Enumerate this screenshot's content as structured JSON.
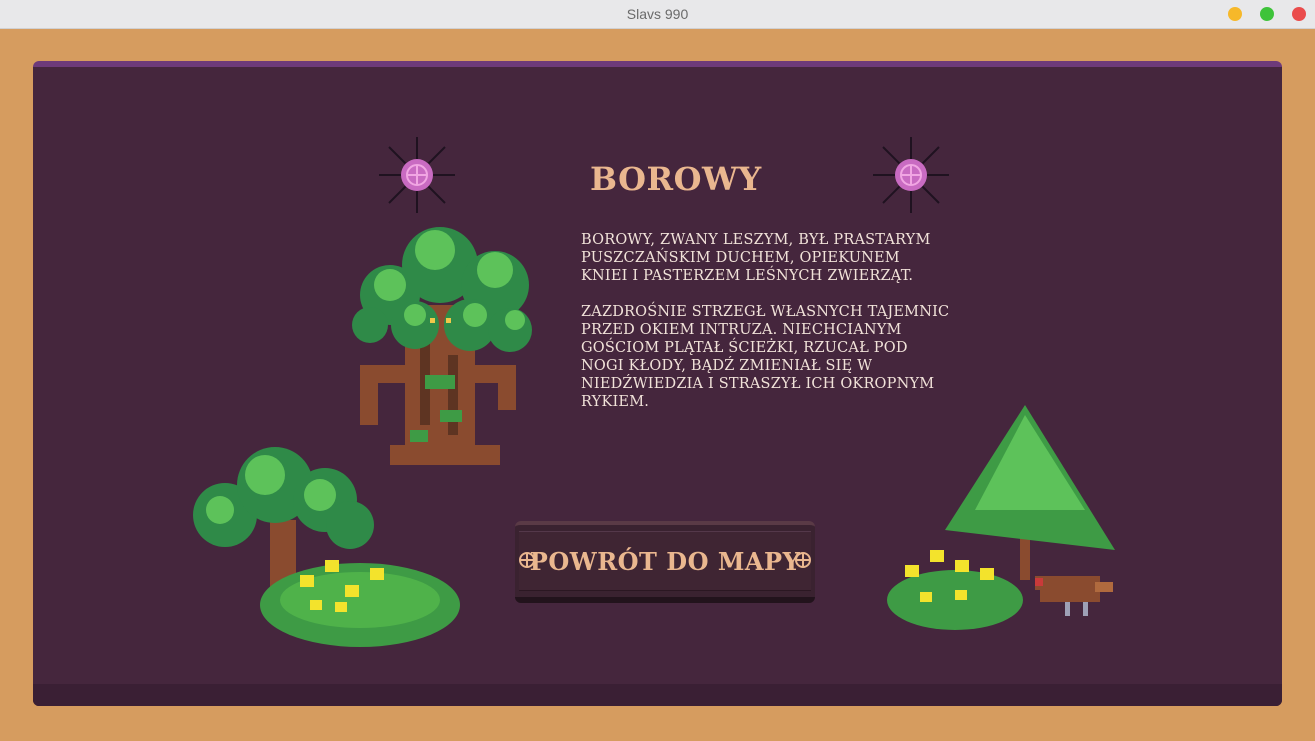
{
  "window": {
    "title": "Slavs 990"
  },
  "panel": {
    "heading": "BOROWY",
    "paragraphs": [
      "Borowy, zwany Leszym, był prastarym puszczańskim duchem, opiekunem kniei i pasterzem leśnych zwierząt.",
      "Zazdrośnie strzegł własnych tajemnic przed okiem intruza. Niechcianym gościom plątał ścieżki, rzucał pod nogi kłody, bądź zmieniał się w niedźwiedzia i straszył ich okropnym rykiem."
    ]
  },
  "back_button": {
    "label": "POWRÓT DO MAPY"
  },
  "colors": {
    "background": "#d69c5f",
    "panel": "#45263d",
    "heading": "#eab78f",
    "text": "#f1e2d9",
    "accent": "#c96bc2"
  },
  "icons": {
    "ornament": "pink-sun-ornament-icon",
    "button_star": "star-icon"
  }
}
